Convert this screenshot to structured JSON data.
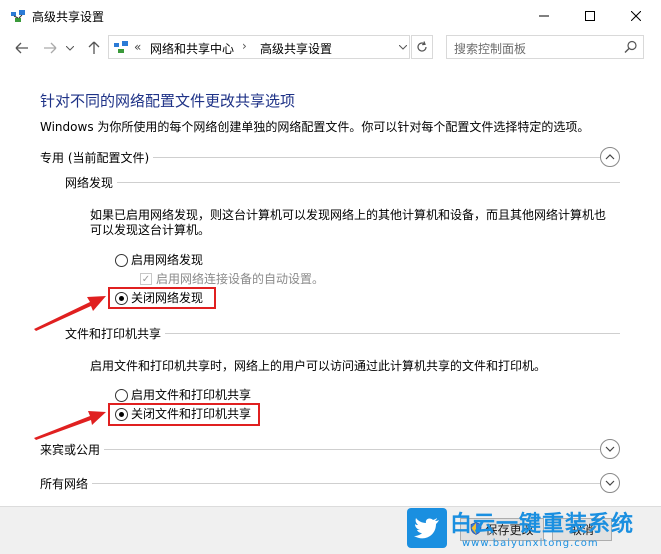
{
  "window": {
    "title": "高级共享设置"
  },
  "nav": {
    "breadcrumb_sep": "«",
    "crumb1": "网络和共享中心",
    "crumb_arrow": "›",
    "crumb2": "高级共享设置",
    "search_placeholder": "搜索控制面板"
  },
  "main": {
    "heading": "针对不同的网络配置文件更改共享选项",
    "description": "Windows 为你所使用的每个网络创建单独的网络配置文件。你可以针对每个配置文件选择特定的选项。",
    "private_profile": {
      "label": "专用 (当前配置文件)",
      "network_discovery": {
        "title": "网络发现",
        "text_line1": "如果已启用网络发现，则这台计算机可以发现网络上的其他计算机和设备，而且其他网络计算机也",
        "text_line2": "可以发现这台计算机。",
        "option_on": "启用网络发现",
        "auto_setup": "启用网络连接设备的自动设置。",
        "option_off": "关闭网络发现",
        "selected": "option_off"
      },
      "file_printer_sharing": {
        "title": "文件和打印机共享",
        "text": "启用文件和打印机共享时，网络上的用户可以访问通过此计算机共享的文件和打印机。",
        "option_on": "启用文件和打印机共享",
        "option_off": "关闭文件和打印机共享",
        "selected": "option_off"
      }
    },
    "guest_public": {
      "label": "来宾或公用"
    },
    "all_networks": {
      "label": "所有网络"
    }
  },
  "footer": {
    "save_label": "保存更改",
    "cancel_label": "取消"
  },
  "watermark": {
    "brand": "白云一键重装系统",
    "url": "www.baiyunxitong.com"
  },
  "colors": {
    "heading": "#1e3287",
    "highlight_box": "#e02020",
    "annotation_arrow": "#e02020",
    "watermark": "#1a8fe0"
  }
}
